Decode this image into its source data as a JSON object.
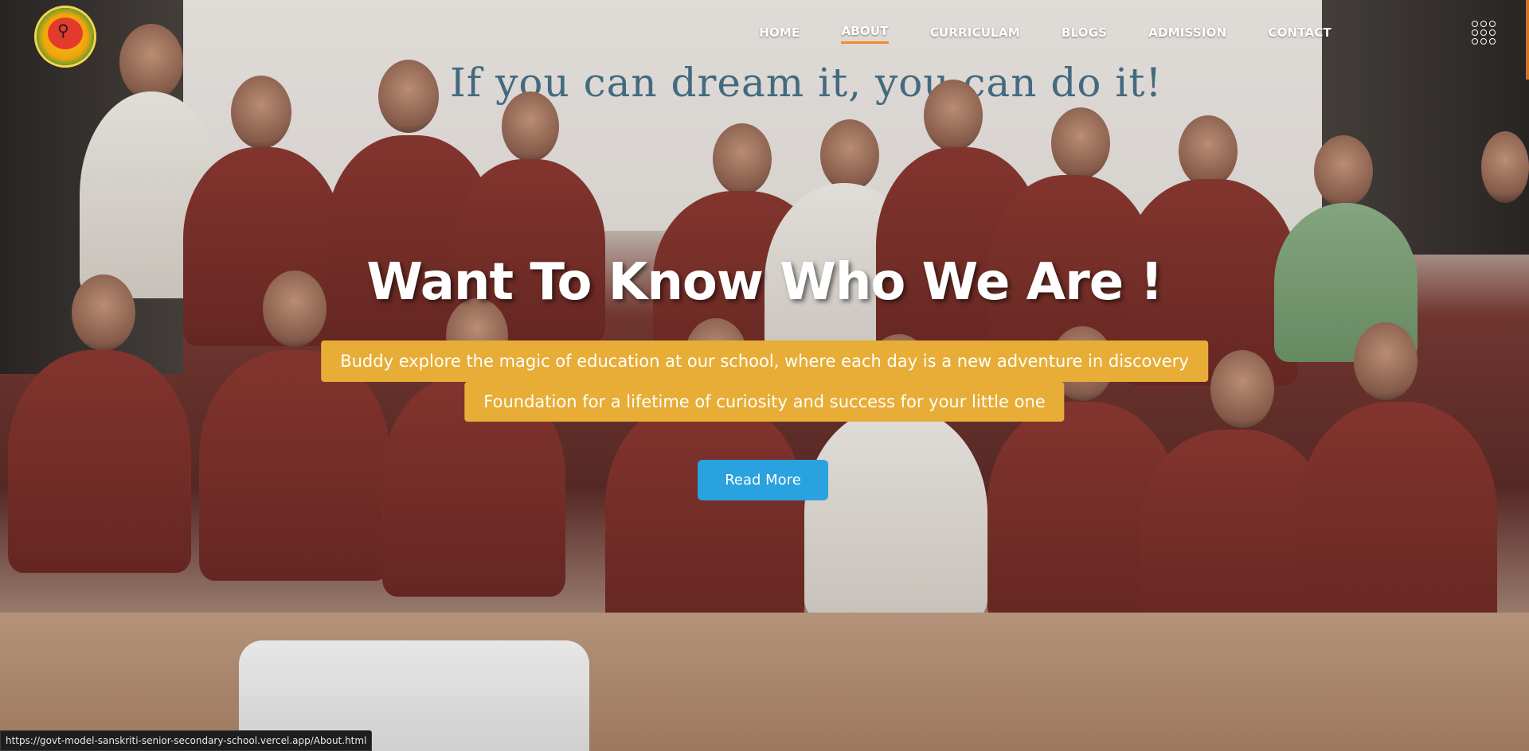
{
  "nav": {
    "items": [
      {
        "label": "HOME",
        "active": false
      },
      {
        "label": "ABOUT",
        "active": true
      },
      {
        "label": "CURRICULAM",
        "active": false
      },
      {
        "label": "BLOGS",
        "active": false
      },
      {
        "label": "ADMISSION",
        "active": false
      },
      {
        "label": "CONTACT",
        "active": false
      }
    ],
    "menu_icon": "grid-dots-icon",
    "active_underline_color": "#f28c28"
  },
  "logo": {
    "icon": "school-logo"
  },
  "background": {
    "banner_text": "If you can dream it, you can do it!"
  },
  "hero": {
    "title": "Want To Know Who We Are !",
    "tagline_line1": "Buddy explore the magic of education at our school, where each day is a new adventure in discovery",
    "tagline_line2": "Foundation for a lifetime of curiosity and success for your little one",
    "cta_label": "Read More",
    "tagline_color": "#e7ad36",
    "cta_color": "#2aa2df"
  },
  "status_bar": {
    "url": "https://govt-model-sanskriti-senior-secondary-school.vercel.app/About.html"
  }
}
